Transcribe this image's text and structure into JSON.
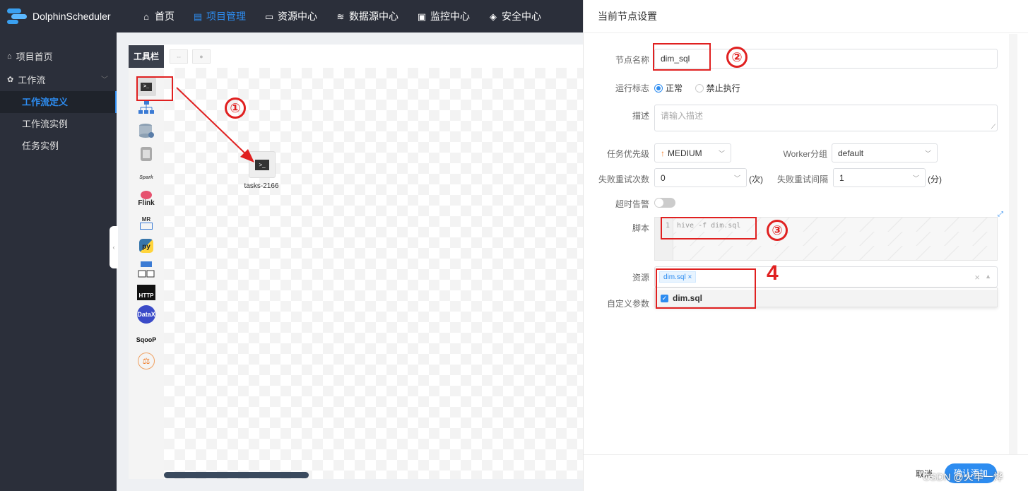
{
  "app": {
    "title": "DolphinScheduler"
  },
  "nav": [
    {
      "label": "首页",
      "icon": "home-icon"
    },
    {
      "label": "项目管理",
      "icon": "project-icon",
      "active": true
    },
    {
      "label": "资源中心",
      "icon": "folder-icon"
    },
    {
      "label": "数据源中心",
      "icon": "database-icon"
    },
    {
      "label": "监控中心",
      "icon": "monitor-icon"
    },
    {
      "label": "安全中心",
      "icon": "shield-icon"
    }
  ],
  "sidebar": {
    "items": [
      {
        "label": "项目首页",
        "icon": "home-icon"
      },
      {
        "label": "工作流",
        "icon": "gear-icon"
      }
    ],
    "sub": [
      {
        "label": "工作流定义",
        "active": true
      },
      {
        "label": "工作流实例"
      },
      {
        "label": "任务实例"
      }
    ]
  },
  "toolbar": {
    "title": "工具栏"
  },
  "tools": [
    "shell-task-icon",
    "sub-process-icon",
    "procedure-icon",
    "sql-icon",
    "spark-icon",
    "flink-icon",
    "mr-icon",
    "python-icon",
    "dependent-icon",
    "http-icon",
    "datax-icon",
    "sqoop-icon",
    "conditions-icon"
  ],
  "tool_labels": {
    "spark": "Spark",
    "flink": "Flink",
    "mr": "MR",
    "py": "py",
    "http": "HTTP",
    "datax": "DataX",
    "sqoop": "SqooP"
  },
  "node": {
    "label": "tasks-2166"
  },
  "panel": {
    "title": "当前节点设置",
    "node_name_label": "节点名称",
    "node_name": "dim_sql",
    "run_flag_label": "运行标志",
    "run_flag_options": [
      "正常",
      "禁止执行"
    ],
    "desc_label": "描述",
    "desc_placeholder": "请输入描述",
    "priority_label": "任务优先级",
    "priority": "MEDIUM",
    "worker_label": "Worker分组",
    "worker": "default",
    "retry_label": "失败重试次数",
    "retry": "0",
    "retry_unit": "(次)",
    "interval_label": "失败重试间隔",
    "interval": "1",
    "interval_unit": "(分)",
    "timeout_label": "超时告警",
    "script_label": "脚本",
    "script_line": "1",
    "script": "hive -f dim.sql",
    "resource_label": "资源",
    "resource_tag": "dim.sql",
    "resource_option": "dim.sql",
    "custom_params_label": "自定义参数",
    "cancel": "取消",
    "confirm": "确认添加"
  },
  "annotations": {
    "a1": "①",
    "a2": "②",
    "a3": "③",
    "a4": "4"
  },
  "watermark": "CSDN @火丰一烨",
  "colors": {
    "accent": "#2d8cf0",
    "dark": "#2b2f3a",
    "annotation": "#e02020"
  }
}
